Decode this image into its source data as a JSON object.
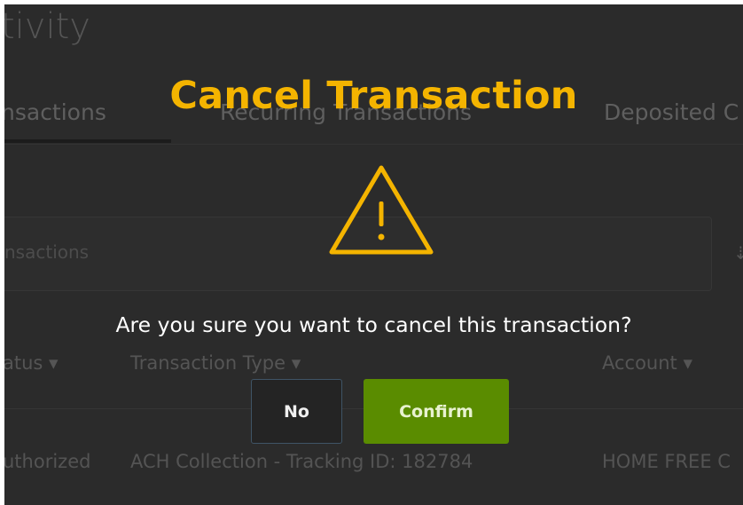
{
  "page": {
    "title": "tivity",
    "tabs": [
      {
        "label": "nsactions"
      },
      {
        "label": "Recurring Transactions"
      },
      {
        "label": "Deposited C"
      }
    ],
    "search": {
      "placeholder": "nsactions",
      "filter_icon": "⇣"
    },
    "table": {
      "columns": [
        {
          "label": "atus",
          "sort_icon": "▾"
        },
        {
          "label": "Transaction Type",
          "sort_icon": "▾"
        },
        {
          "label": "Account",
          "sort_icon": "▾"
        }
      ],
      "rows": [
        {
          "status": "uthorized",
          "type": "ACH Collection - Tracking ID: 182784",
          "account": "HOME FREE C"
        }
      ]
    }
  },
  "modal": {
    "title": "Cancel Transaction",
    "icon": "warning-triangle",
    "accent_color": "#f4b400",
    "message": "Are you sure you want to cancel this transaction?",
    "buttons": {
      "no_label": "No",
      "confirm_label": "Confirm",
      "confirm_color": "#5a8c00"
    }
  }
}
